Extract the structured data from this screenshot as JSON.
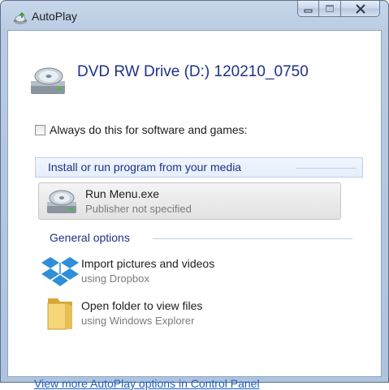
{
  "window": {
    "title": "AutoPlay",
    "controls": {
      "minimize": "minimize",
      "maximize": "maximize",
      "close": "close"
    }
  },
  "drive": {
    "title": "DVD RW Drive (D:) 120210_0750",
    "icon": "dvd-drive-icon"
  },
  "always_checkbox": {
    "label": "Always do this for software and games:",
    "checked": false
  },
  "install_section": {
    "header": "Install or run program from your media",
    "items": [
      {
        "title": "Run Menu.exe",
        "subtitle": "Publisher not specified",
        "icon": "dvd-drive-icon"
      }
    ]
  },
  "general_section": {
    "header": "General options",
    "items": [
      {
        "title": "Import pictures and videos",
        "subtitle": "using Dropbox",
        "icon": "dropbox-icon"
      },
      {
        "title": "Open folder to view files",
        "subtitle": "using Windows Explorer",
        "icon": "folder-icon"
      }
    ]
  },
  "footer": {
    "link": "View more AutoPlay options in Control Panel"
  },
  "colors": {
    "accent_text": "#1e3287",
    "link": "#1b5ec2",
    "frame": "#b9cbe2"
  }
}
